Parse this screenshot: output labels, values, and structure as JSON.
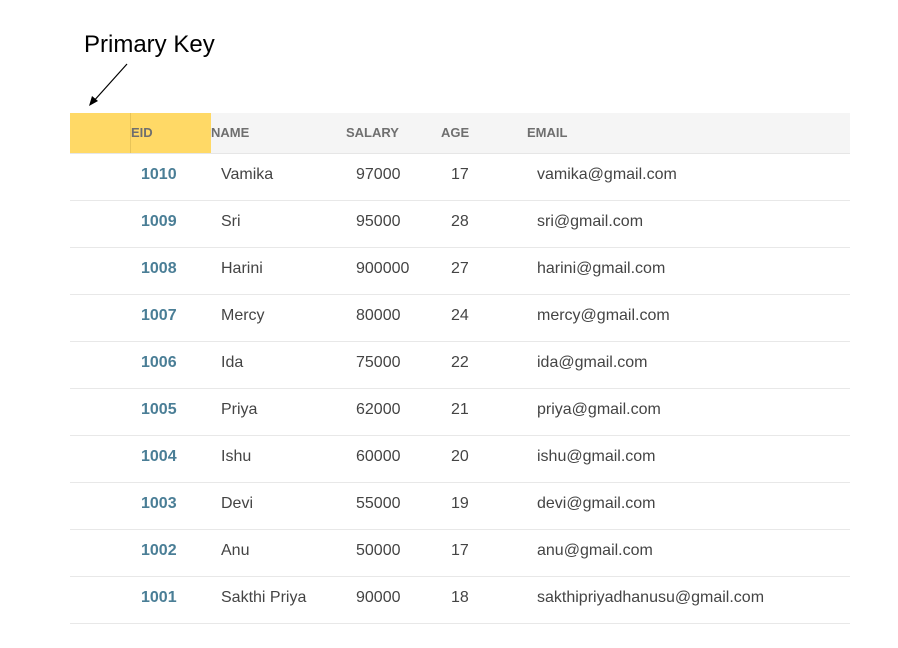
{
  "annotation": {
    "label": "Primary Key"
  },
  "colors": {
    "primary_key_highlight": "#ffd966",
    "eid_text": "#4a7e96",
    "header_background": "#f5f5f5"
  },
  "table": {
    "headers": {
      "eid": "EID",
      "name": "NAME",
      "salary": "SALARY",
      "age": "AGE",
      "email": "EMAIL"
    },
    "rows": [
      {
        "eid": "1010",
        "name": "Vamika",
        "salary": "97000",
        "age": "17",
        "email": "vamika@gmail.com"
      },
      {
        "eid": "1009",
        "name": "Sri",
        "salary": "95000",
        "age": "28",
        "email": "sri@gmail.com"
      },
      {
        "eid": "1008",
        "name": "Harini",
        "salary": "900000",
        "age": "27",
        "email": "harini@gmail.com"
      },
      {
        "eid": "1007",
        "name": "Mercy",
        "salary": "80000",
        "age": "24",
        "email": "mercy@gmail.com"
      },
      {
        "eid": "1006",
        "name": "Ida",
        "salary": "75000",
        "age": "22",
        "email": "ida@gmail.com"
      },
      {
        "eid": "1005",
        "name": "Priya",
        "salary": "62000",
        "age": "21",
        "email": "priya@gmail.com"
      },
      {
        "eid": "1004",
        "name": "Ishu",
        "salary": "60000",
        "age": "20",
        "email": "ishu@gmail.com"
      },
      {
        "eid": "1003",
        "name": "Devi",
        "salary": "55000",
        "age": "19",
        "email": "devi@gmail.com"
      },
      {
        "eid": "1002",
        "name": "Anu",
        "salary": "50000",
        "age": "17",
        "email": "anu@gmail.com"
      },
      {
        "eid": "1001",
        "name": "Sakthi Priya",
        "salary": "90000",
        "age": "18",
        "email": "sakthipriyadhanusu@gmail.com"
      }
    ]
  }
}
